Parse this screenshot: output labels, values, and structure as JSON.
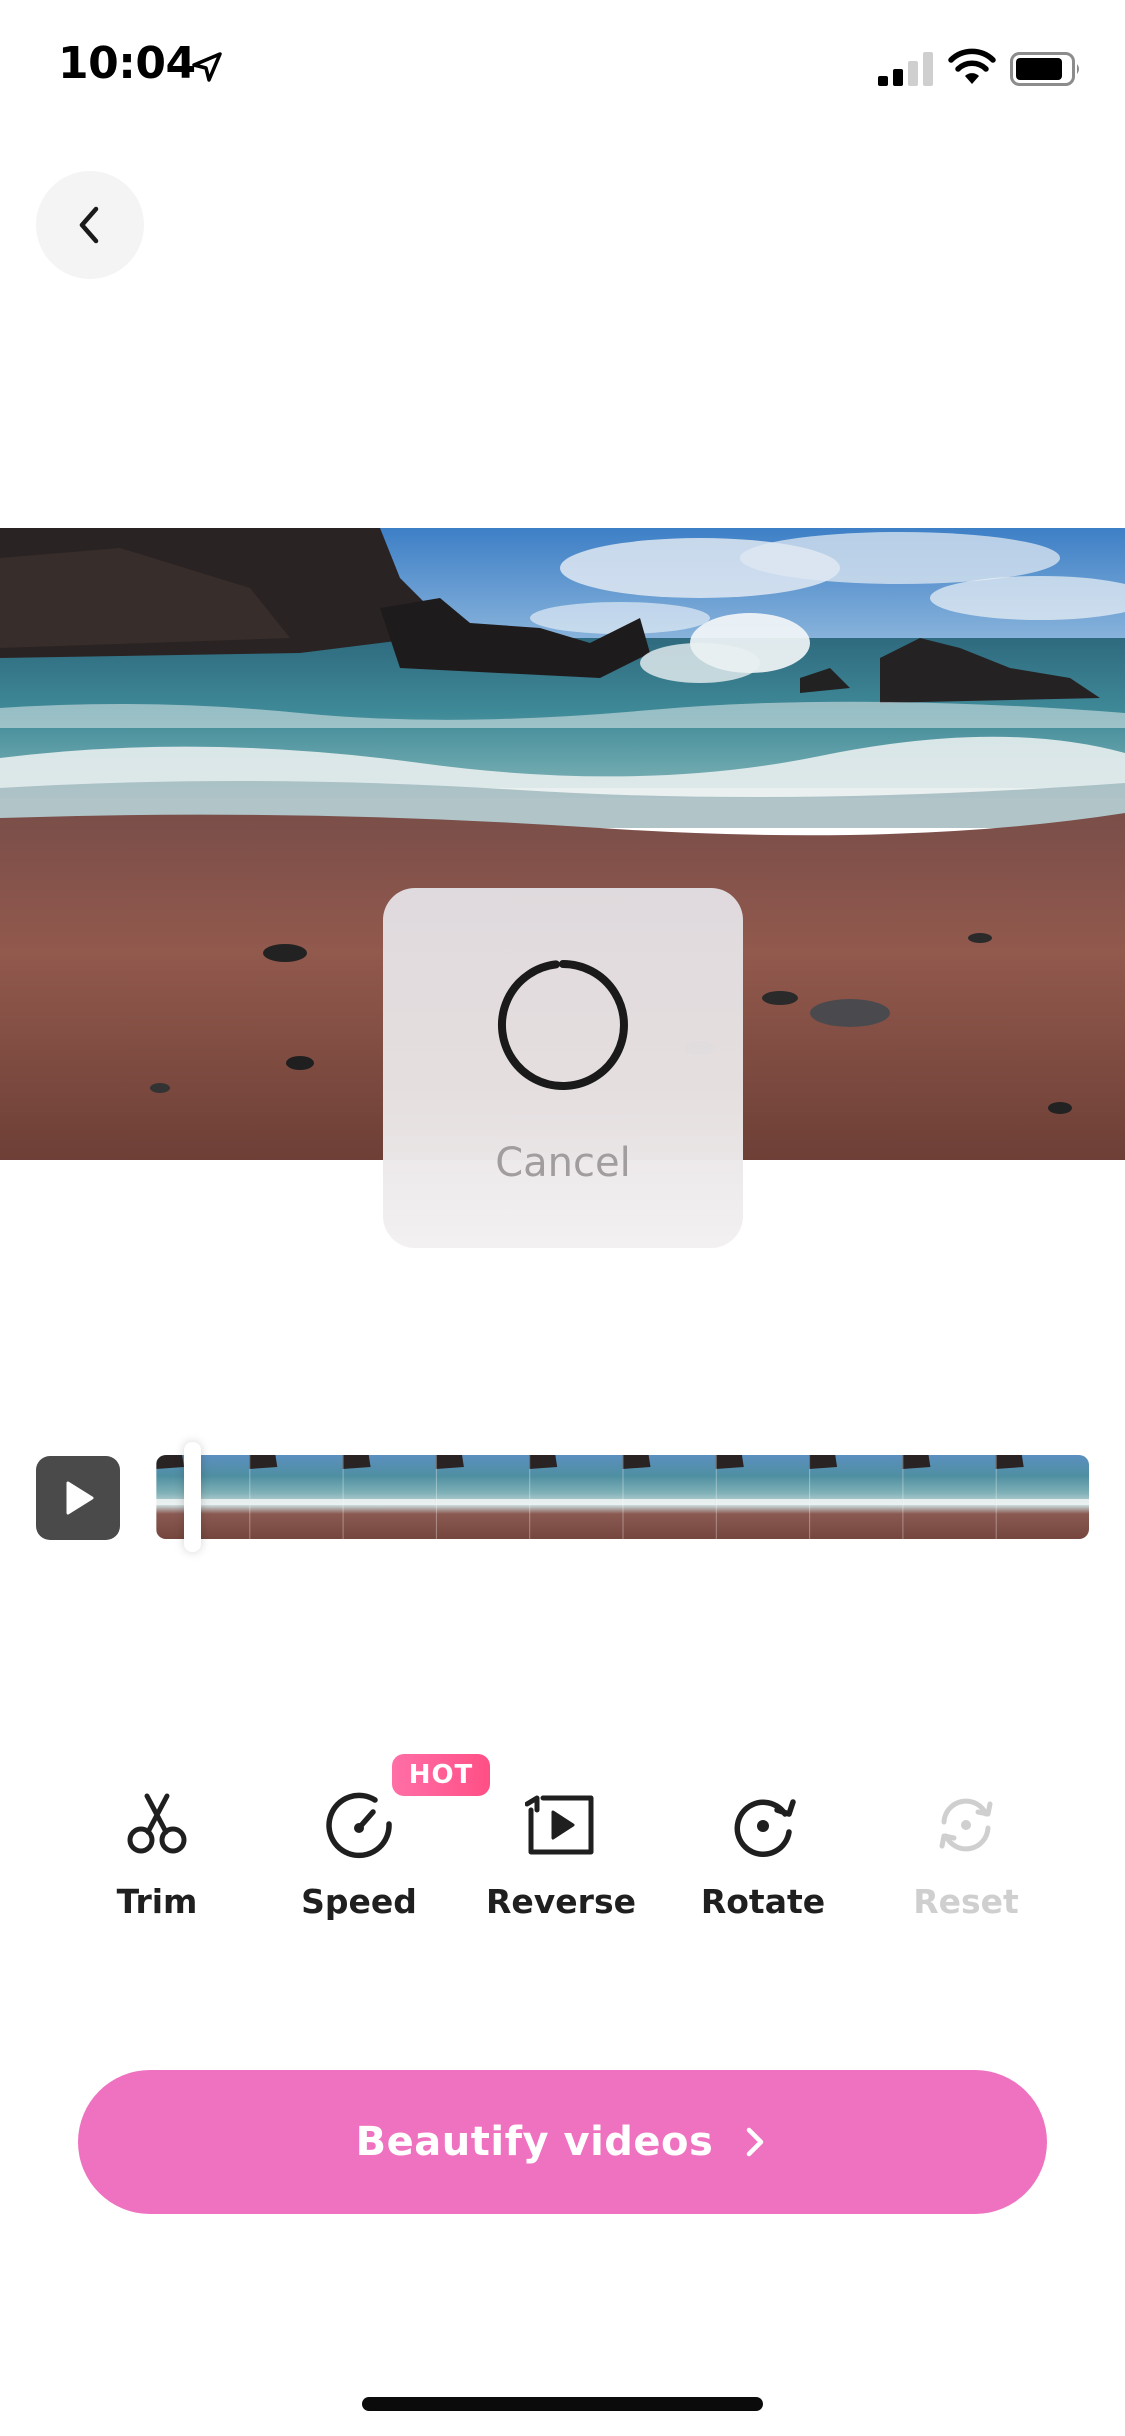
{
  "status_bar": {
    "time": "10:04",
    "icons": [
      "location-arrow-icon",
      "cellular-signal-icon",
      "wifi-icon",
      "battery-icon"
    ]
  },
  "header": {
    "back_icon": "chevron-left-icon"
  },
  "loading_dialog": {
    "spinner_icon": "loading-spinner-icon",
    "cancel_label": "Cancel"
  },
  "timeline": {
    "play_icon": "play-icon",
    "frame_count": 10
  },
  "tools": [
    {
      "id": "trim",
      "label": "Trim",
      "icon": "scissors-icon",
      "enabled": true
    },
    {
      "id": "speed",
      "label": "Speed",
      "icon": "speedometer-icon",
      "enabled": true,
      "badge": "HOT"
    },
    {
      "id": "reverse",
      "label": "Reverse",
      "icon": "reverse-play-icon",
      "enabled": true
    },
    {
      "id": "rotate",
      "label": "Rotate",
      "icon": "rotate-icon",
      "enabled": true
    },
    {
      "id": "reset",
      "label": "Reset",
      "icon": "reset-icon",
      "enabled": false
    }
  ],
  "cta": {
    "label": "Beautify videos",
    "icon": "chevron-right-icon"
  },
  "colors": {
    "accent": "#ef72c0",
    "hot_badge": "#ff5a8f",
    "disabled_text": "#cfcfcf",
    "cancel_text": "#a19c9e"
  }
}
